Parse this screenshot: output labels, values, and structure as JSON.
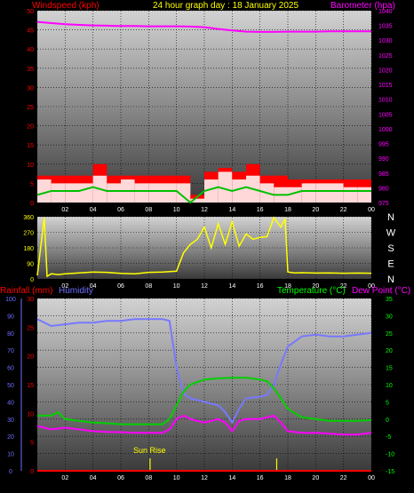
{
  "header": {
    "windspeed_label": "Windspeed (kph)",
    "title": "24 hour graph day : 18 January 2025",
    "barometer_label": "Barometer (hpa)"
  },
  "bottom_header": {
    "rainfall_label": "Rainfall (mm)",
    "humidity_label": "Humidity",
    "temperature_label": "Temperature (°C)",
    "dewpoint_label": "Dew Point (°C)"
  },
  "annotations": {
    "sunrise": "Sun Rise"
  },
  "colors": {
    "wind": "#ff0000",
    "gust_fill": "#ffffff",
    "wind_avg": "#00c000",
    "barometer": "#ff00ff",
    "direction": "#ffff00",
    "humidity": "#7878ff",
    "temperature": "#00d000",
    "dewpoint": "#ff00ff",
    "rainfall": "#ff0000",
    "label_red": "#ff0000",
    "label_yellow": "#ffff00",
    "label_magenta": "#ff00ff",
    "label_blue": "#6e6eff",
    "label_green": "#00ff00"
  },
  "chart_data": [
    {
      "type": "line",
      "title": "24 hour graph day : 18 January 2025",
      "x_ticks": [
        "02",
        "04",
        "06",
        "08",
        "10",
        "12",
        "14",
        "16",
        "18",
        "20",
        "22",
        "00"
      ],
      "left_axis": {
        "label": "Windspeed (kph)",
        "ylim": [
          0,
          50
        ],
        "ticks": [
          "0",
          "5",
          "10",
          "15",
          "20",
          "25",
          "30",
          "35",
          "40",
          "45",
          "50"
        ]
      },
      "right_axis": {
        "label": "Barometer (hpa)",
        "ylim": [
          975,
          1040
        ],
        "ticks": [
          "975",
          "980",
          "985",
          "990",
          "995",
          "1000",
          "1005",
          "1010",
          "1015",
          "1020",
          "1025",
          "1030",
          "1035",
          "1040"
        ]
      },
      "series": [
        {
          "name": "Windspeed (kph)",
          "axis": "left",
          "x": [
            0,
            1,
            2,
            3,
            4,
            5,
            6,
            7,
            8,
            9,
            10,
            11,
            12,
            13,
            14,
            15,
            16,
            17,
            18,
            19,
            20,
            21,
            22,
            23,
            24
          ],
          "values": [
            6,
            5,
            5,
            5,
            7,
            5,
            6,
            5,
            5,
            5,
            5,
            1,
            6,
            8,
            6,
            7,
            5,
            4,
            4,
            5,
            5,
            5,
            4,
            4,
            4
          ],
          "gusts": [
            7,
            7,
            7,
            7,
            10,
            7,
            7,
            7,
            7,
            7,
            7,
            2,
            8,
            9,
            8,
            10,
            7,
            7,
            6,
            6,
            6,
            6,
            6,
            6,
            6
          ],
          "average": [
            2,
            3,
            3,
            3,
            4,
            3,
            3,
            3,
            3,
            3,
            3,
            0,
            3,
            4,
            3,
            4,
            3,
            2,
            2,
            3,
            3,
            3,
            3,
            3,
            3
          ]
        },
        {
          "name": "Barometer (hpa)",
          "axis": "right",
          "x": [
            0,
            1,
            2,
            3,
            4,
            5,
            6,
            7,
            8,
            9,
            10,
            11,
            12,
            13,
            14,
            15,
            16,
            17,
            18,
            19,
            20,
            21,
            22,
            23,
            24
          ],
          "values": [
            1036.2,
            1035.8,
            1035.4,
            1035.2,
            1035.0,
            1034.9,
            1034.8,
            1034.8,
            1034.7,
            1034.7,
            1034.7,
            1034.6,
            1034.4,
            1033.8,
            1033.3,
            1032.9,
            1032.8,
            1032.8,
            1032.9,
            1032.9,
            1032.9,
            1033.0,
            1033.0,
            1033.0,
            1033.0
          ]
        }
      ]
    },
    {
      "type": "line",
      "x_ticks": [
        "02",
        "04",
        "06",
        "08",
        "10",
        "12",
        "14",
        "16",
        "18",
        "20",
        "22",
        "00"
      ],
      "left_axis": {
        "ylim": [
          0,
          360
        ],
        "ticks": [
          "0",
          "90",
          "180",
          "270",
          "360"
        ]
      },
      "direction_labels": [
        "N",
        "W",
        "S",
        "E",
        "N"
      ],
      "series": [
        {
          "name": "Wind direction",
          "x": [
            0,
            0.5,
            0.7,
            1.0,
            1.5,
            2,
            3,
            4,
            5,
            6,
            7,
            8,
            9,
            10,
            10.5,
            11,
            11.5,
            12,
            12.5,
            13,
            13.5,
            14,
            14.5,
            15,
            15.5,
            16,
            16.5,
            17,
            17.5,
            17.8,
            18,
            18.5,
            19,
            20,
            21,
            22,
            23,
            24
          ],
          "values": [
            20,
            355,
            15,
            30,
            25,
            30,
            35,
            40,
            38,
            32,
            30,
            38,
            40,
            45,
            150,
            200,
            230,
            300,
            180,
            320,
            200,
            330,
            190,
            260,
            230,
            240,
            245,
            355,
            300,
            350,
            40,
            35,
            36,
            34,
            35,
            33,
            34,
            33
          ]
        }
      ]
    },
    {
      "type": "line",
      "x_ticks": [
        "02",
        "04",
        "06",
        "08",
        "10",
        "12",
        "14",
        "16",
        "18",
        "20",
        "22",
        "00"
      ],
      "humidity_axis": {
        "label": "Humidity",
        "ylim": [
          0,
          100
        ],
        "ticks": [
          "0",
          "10",
          "20",
          "30",
          "40",
          "50",
          "60",
          "70",
          "80",
          "90",
          "100"
        ]
      },
      "rainfall_axis": {
        "label": "Rainfall (mm)",
        "ylim": [
          0,
          30
        ],
        "ticks": [
          "0",
          "5",
          "10",
          "15",
          "20",
          "25",
          "30"
        ]
      },
      "temperature_axis": {
        "label": "Temperature (°C)",
        "ylim": [
          -15,
          35
        ],
        "ticks": [
          "-15",
          "-10",
          "-5",
          "0",
          "5",
          "10",
          "15",
          "20",
          "25",
          "30",
          "35"
        ]
      },
      "series": [
        {
          "name": "Humidity",
          "axis": "humidity",
          "x": [
            0,
            1,
            2,
            3,
            4,
            5,
            6,
            7,
            8,
            9,
            9.5,
            10,
            10.5,
            11,
            12,
            13,
            13.5,
            14,
            14.5,
            15,
            16,
            16.5,
            17,
            17.5,
            18,
            19,
            20,
            21,
            22,
            23,
            24
          ],
          "values": [
            88,
            84,
            85,
            86,
            86,
            87,
            87,
            88,
            88,
            88,
            87,
            60,
            45,
            42,
            40,
            38,
            34,
            28,
            36,
            42,
            43,
            44,
            50,
            62,
            72,
            78,
            79,
            78,
            78,
            79,
            80
          ]
        },
        {
          "name": "Temperature (°C)",
          "axis": "temperature",
          "x": [
            0,
            1,
            1.5,
            2,
            3,
            4,
            5,
            6,
            7,
            8,
            9,
            9.5,
            10,
            10.5,
            11,
            12,
            13,
            14,
            15,
            16,
            16.5,
            17,
            17.5,
            18,
            19,
            20,
            21,
            22,
            23,
            24
          ],
          "values": [
            1,
            1,
            2,
            0,
            -0.5,
            -1,
            -1.2,
            -1.5,
            -1.5,
            -1.5,
            -1.5,
            0,
            4,
            8,
            10,
            11.5,
            11.8,
            12,
            12,
            11.5,
            11,
            9,
            6,
            3,
            0.5,
            0,
            -0.5,
            -0.5,
            -0.5,
            -0.3
          ]
        },
        {
          "name": "Dew Point (°C)",
          "axis": "temperature",
          "x": [
            0,
            1,
            2,
            3,
            4,
            5,
            6,
            7,
            8,
            9,
            9.5,
            10,
            10.5,
            11,
            12,
            13,
            13.5,
            14,
            14.5,
            15,
            16,
            16.5,
            17,
            17.5,
            18,
            19,
            20,
            21,
            22,
            23,
            24
          ],
          "values": [
            -2,
            -3,
            -2.5,
            -3,
            -3.5,
            -3.7,
            -3.8,
            -4,
            -4,
            -4,
            -3,
            0,
            1,
            0,
            -1,
            0,
            -1,
            -3.5,
            -0.5,
            0,
            0,
            0.5,
            1,
            -1,
            -3.5,
            -4,
            -4,
            -4.2,
            -4.5,
            -4.5,
            -4
          ]
        },
        {
          "name": "Rainfall (mm)",
          "axis": "rainfall",
          "x": [
            0,
            24
          ],
          "values": [
            0,
            0
          ]
        }
      ],
      "markers": [
        {
          "label": "Sun Rise",
          "x": 8.1
        },
        {
          "label": "",
          "x": 17.2
        }
      ]
    }
  ]
}
